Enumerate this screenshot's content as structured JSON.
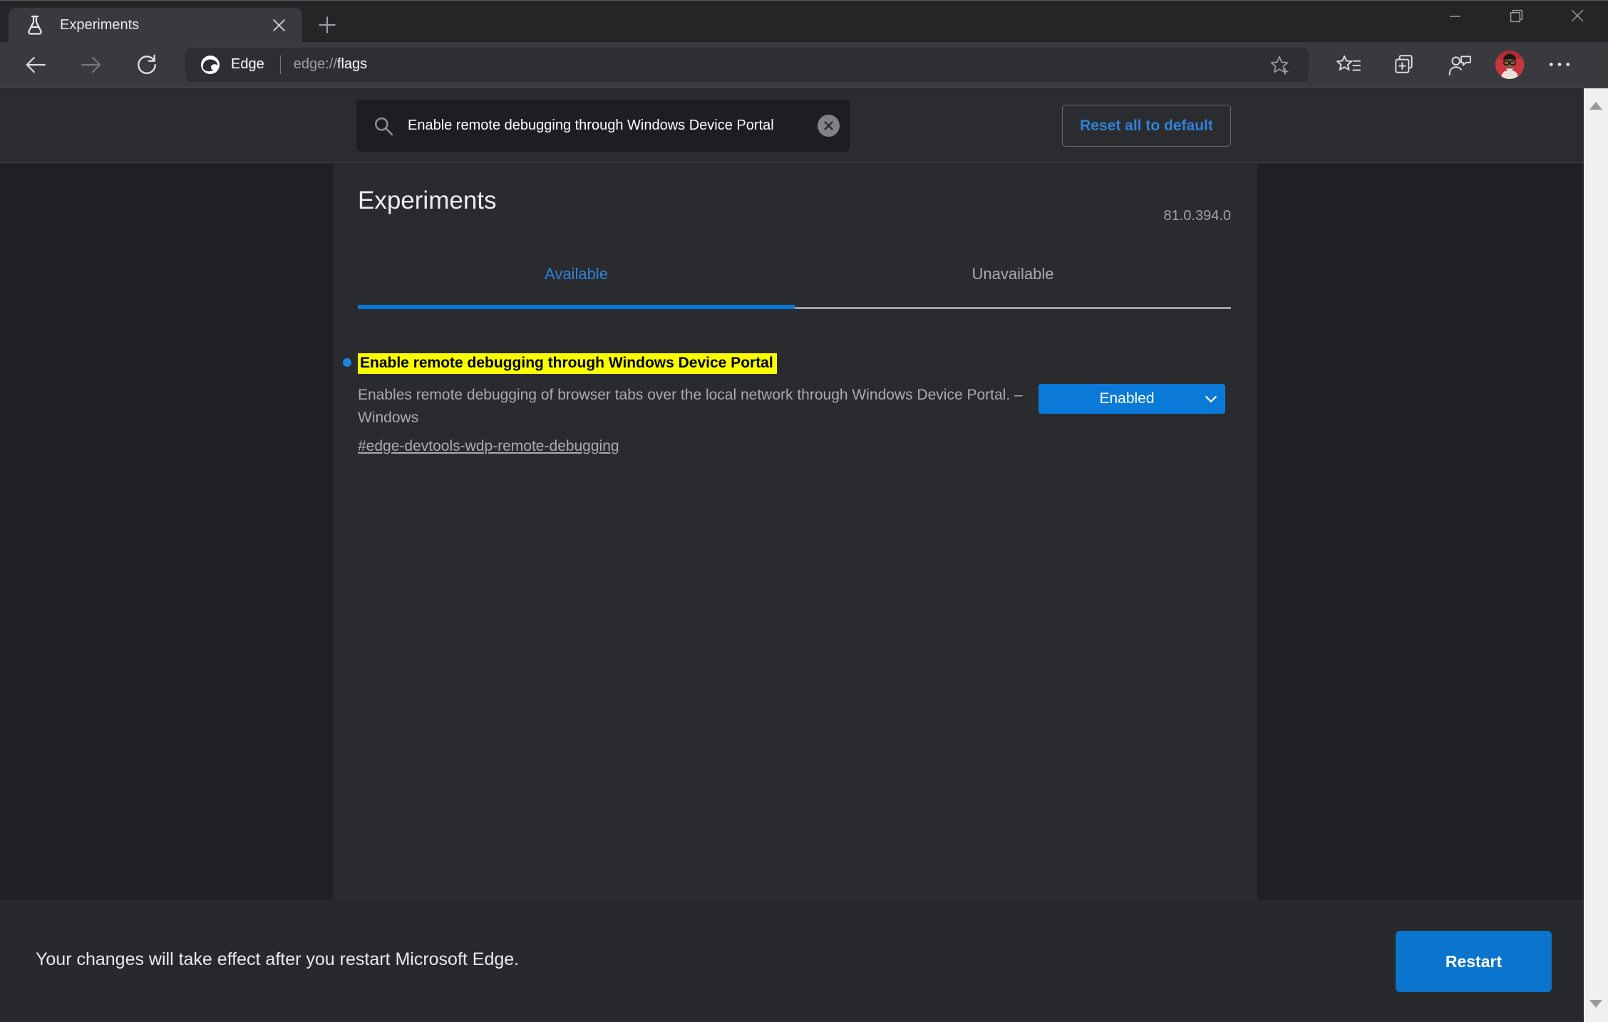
{
  "tab_bar": {
    "tab_title": "Experiments"
  },
  "toolbar": {
    "site_button_label": "Edge",
    "url_scheme": "edge://",
    "url_path": "flags"
  },
  "search": {
    "value": "Enable remote debugging through Windows Device Portal",
    "reset_button_label": "Reset all to default"
  },
  "page": {
    "title": "Experiments",
    "version": "81.0.394.0",
    "tabs": [
      {
        "label": "Available",
        "active": true
      },
      {
        "label": "Unavailable",
        "active": false
      }
    ],
    "flag": {
      "title": "Enable remote debugging through Windows Device Portal",
      "description": "Enables remote debugging of browser tabs over the local network through Windows Device Portal. – Windows",
      "link": "#edge-devtools-wdp-remote-debugging",
      "state": "Enabled"
    }
  },
  "footer": {
    "message": "Your changes will take effect after you restart Microsoft Edge.",
    "restart_button_label": "Restart"
  },
  "colors": {
    "accent_blue": "#0a79d8",
    "accent_text_blue": "#2f82d6",
    "restart_blue": "#0b74cd",
    "highlight_yellow": "#f9fd00",
    "toolbar_bg": "#393a3e",
    "column_bg": "#2a2b2f"
  }
}
